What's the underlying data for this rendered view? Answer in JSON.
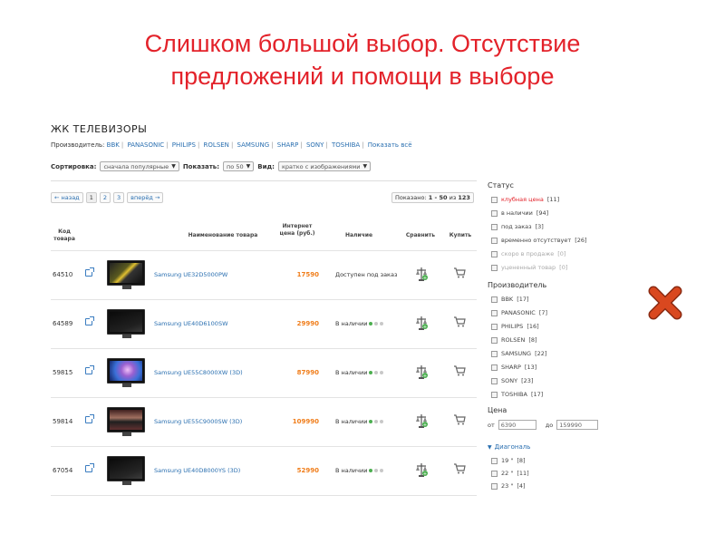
{
  "slide": {
    "title_line1": "Слишком большой выбор. Отсутствие",
    "title_line2": "предложений и помощи в выборе"
  },
  "page": {
    "heading": "ЖК ТЕЛЕВИЗОРЫ",
    "maker_label": "Производитель:",
    "makers": [
      "BBK",
      "PANASONIC",
      "PHILIPS",
      "ROLSEN",
      "SAMSUNG",
      "SHARP",
      "SONY",
      "TOSHIBA"
    ],
    "show_all": "Показать всё"
  },
  "controls": {
    "sort_label": "Сортировка:",
    "sort_value": "сначала популярные",
    "show_label": "Показать:",
    "show_value": "по 50",
    "view_label": "Вид:",
    "view_value": "кратко с изображениями"
  },
  "pager": {
    "prev": "← назад",
    "pages": [
      "1",
      "2",
      "3"
    ],
    "next": "вперёд →",
    "shown_prefix": "Показано:",
    "shown_range": "1 - 50",
    "shown_of": "из",
    "shown_total": "123"
  },
  "table": {
    "col_code": "Код товара",
    "col_name": "Наименование товара",
    "col_price": "Интернет цена (руб.)",
    "col_avail": "Наличие",
    "col_compare": "Сравнить",
    "col_buy": "Купить",
    "rows": [
      {
        "code": "64510",
        "name": "Samsung UE32D5000PW",
        "price": "17590",
        "avail": "Доступен под заказ",
        "dots": false
      },
      {
        "code": "64589",
        "name": "Samsung UE40D6100SW",
        "price": "29990",
        "avail": "В наличии",
        "dots": true
      },
      {
        "code": "59815",
        "name": "Samsung UE55C8000XW (3D)",
        "price": "87990",
        "avail": "В наличии",
        "dots": true
      },
      {
        "code": "59814",
        "name": "Samsung UE55C9000SW (3D)",
        "price": "109990",
        "avail": "В наличии",
        "dots": true
      },
      {
        "code": "67054",
        "name": "Samsung UE40D8000YS (3D)",
        "price": "52990",
        "avail": "В наличии",
        "dots": true
      }
    ]
  },
  "filters": {
    "status_title": "Статус",
    "status_items": [
      {
        "label": "клубная цена",
        "count": "[11]",
        "muted": false,
        "red": true
      },
      {
        "label": "в наличии",
        "count": "[94]",
        "muted": false,
        "red": false
      },
      {
        "label": "под заказ",
        "count": "[3]",
        "muted": false,
        "red": false
      },
      {
        "label": "временно отсутствует",
        "count": "[26]",
        "muted": false,
        "red": false
      },
      {
        "label": "скоро в продаже",
        "count": "[0]",
        "muted": true,
        "red": false
      },
      {
        "label": "уцененный товар",
        "count": "[0]",
        "muted": true,
        "red": false
      }
    ],
    "maker_title": "Производитель",
    "maker_items": [
      {
        "label": "BBK",
        "count": "[17]"
      },
      {
        "label": "PANASONIC",
        "count": "[7]"
      },
      {
        "label": "PHILIPS",
        "count": "[16]"
      },
      {
        "label": "ROLSEN",
        "count": "[8]"
      },
      {
        "label": "SAMSUNG",
        "count": "[22]"
      },
      {
        "label": "SHARP",
        "count": "[13]"
      },
      {
        "label": "SONY",
        "count": "[23]"
      },
      {
        "label": "TOSHIBA",
        "count": "[17]"
      }
    ],
    "price_title": "Цена",
    "price_from_label": "от",
    "price_from": "6390",
    "price_to_label": "до",
    "price_to": "159990",
    "diag_title": "Диагональ",
    "diag_items": [
      {
        "label": "19 \"",
        "count": "[8]"
      },
      {
        "label": "22 \"",
        "count": "[11]"
      },
      {
        "label": "23 \"",
        "count": "[4]"
      }
    ]
  },
  "colors": {
    "title_red": "#e3222a",
    "link_blue": "#2a6fb0",
    "price_orange": "#f07d1a",
    "x_red": "#d9481f"
  },
  "icons": [
    "compare-popup-icon",
    "scale-compare-icon",
    "cart-icon",
    "red-x-icon",
    "triangle-down-icon"
  ]
}
